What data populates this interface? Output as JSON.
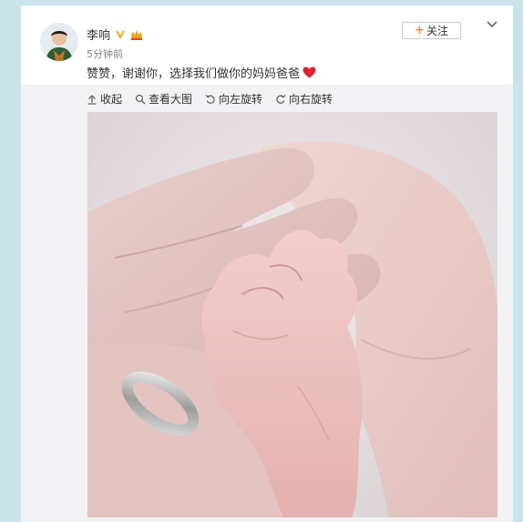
{
  "post": {
    "username": "李响",
    "timestamp": "5分钟前",
    "text": "赞赞，谢谢你，选择我们做你的妈妈爸爸",
    "follow_label": "关注",
    "follow_plus": "+"
  },
  "toolbar": {
    "collapse_label": "收起",
    "view_large_label": "查看大图",
    "rotate_left_label": "向左旋转",
    "rotate_right_label": "向右旋转"
  },
  "colors": {
    "page_background": "#c9e3ea",
    "accent_orange": "#ff8140",
    "verified_gold": "#f5a623",
    "heart_red": "#e0202c"
  },
  "icons": {
    "verified": "verified-badge-icon",
    "crown": "crown-icon",
    "heart": "heart-icon",
    "more": "chevron-down-icon",
    "collapse": "collapse-up-icon",
    "view_large": "magnifier-icon",
    "rotate_left": "rotate-left-icon",
    "rotate_right": "rotate-right-icon"
  }
}
